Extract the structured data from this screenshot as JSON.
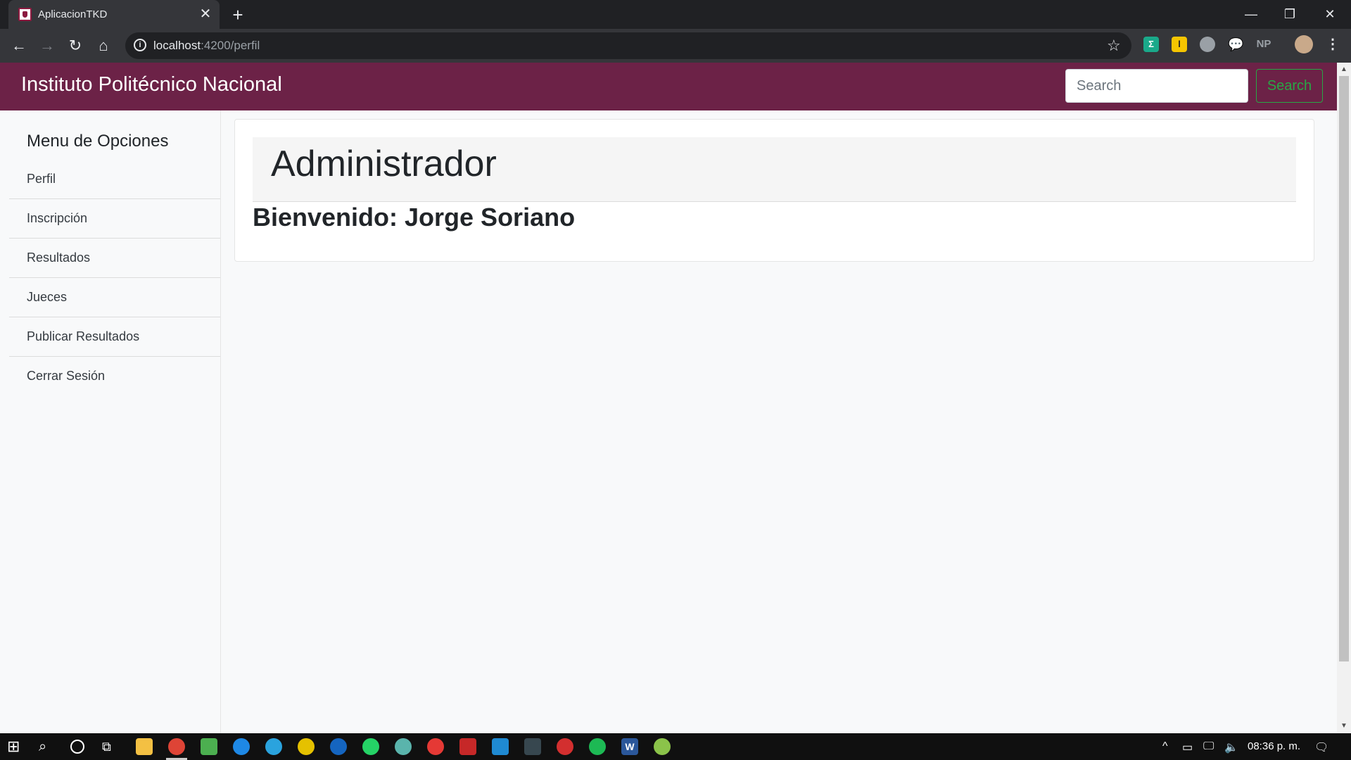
{
  "browser": {
    "tab_title": "AplicacionTKD",
    "url_host": "localhost",
    "url_rest": ":4200/perfil",
    "ext_np": "NP"
  },
  "navbar": {
    "brand": "Instituto Politécnico Nacional",
    "search_placeholder": "Search",
    "search_button": "Search"
  },
  "sidebar": {
    "heading": "Menu de Opciones",
    "items": [
      {
        "label": "Perfil"
      },
      {
        "label": "Inscripción"
      },
      {
        "label": "Resultados"
      },
      {
        "label": "Jueces"
      },
      {
        "label": "Publicar Resultados"
      },
      {
        "label": "Cerrar Sesión"
      }
    ]
  },
  "main": {
    "title": "Administrador",
    "welcome": "Bienvenido: Jorge Soriano"
  },
  "taskbar": {
    "clock": "08:36 p. m."
  },
  "colors": {
    "navbar": "#6c2247",
    "search_accent": "#28a745"
  }
}
